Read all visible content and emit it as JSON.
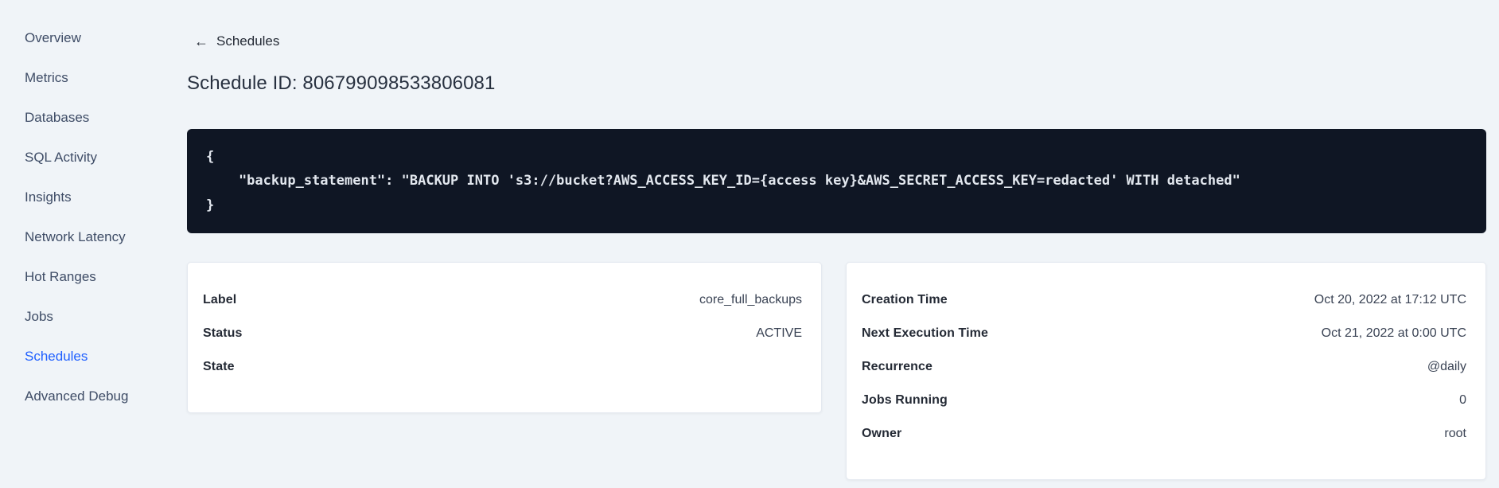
{
  "colors": {
    "page_background": "#f0f4f8",
    "accent_blue": "#2060ff",
    "code_background": "#0f1624",
    "code_text": "#e2e7ee",
    "text_dark": "#242a35"
  },
  "sidebar": {
    "items": [
      {
        "label": "Overview",
        "active": false
      },
      {
        "label": "Metrics",
        "active": false
      },
      {
        "label": "Databases",
        "active": false
      },
      {
        "label": "SQL Activity",
        "active": false
      },
      {
        "label": "Insights",
        "active": false
      },
      {
        "label": "Network Latency",
        "active": false
      },
      {
        "label": "Hot Ranges",
        "active": false
      },
      {
        "label": "Jobs",
        "active": false
      },
      {
        "label": "Schedules",
        "active": true
      },
      {
        "label": "Advanced Debug",
        "active": false
      }
    ]
  },
  "header": {
    "back_arrow": "←",
    "back_label": "Schedules",
    "title": "Schedule ID: 806799098533806081"
  },
  "code_block": {
    "lines": [
      "{",
      "    \"backup_statement\": \"BACKUP INTO 's3://bucket?AWS_ACCESS_KEY_ID={access key}&AWS_SECRET_ACCESS_KEY=redacted' WITH detached\"",
      "}"
    ]
  },
  "details_card": {
    "rows": [
      {
        "label": "Label",
        "value": "core_full_backups"
      },
      {
        "label": "Status",
        "value": "ACTIVE"
      },
      {
        "label": "State",
        "value": ""
      }
    ]
  },
  "schedule_card": {
    "rows": [
      {
        "label": "Creation Time",
        "value": "Oct 20, 2022 at 17:12 UTC"
      },
      {
        "label": "Next Execution Time",
        "value": "Oct 21, 2022 at 0:00 UTC"
      },
      {
        "label": "Recurrence",
        "value": "@daily"
      },
      {
        "label": "Jobs Running",
        "value": "0"
      },
      {
        "label": "Owner",
        "value": "root"
      }
    ]
  }
}
